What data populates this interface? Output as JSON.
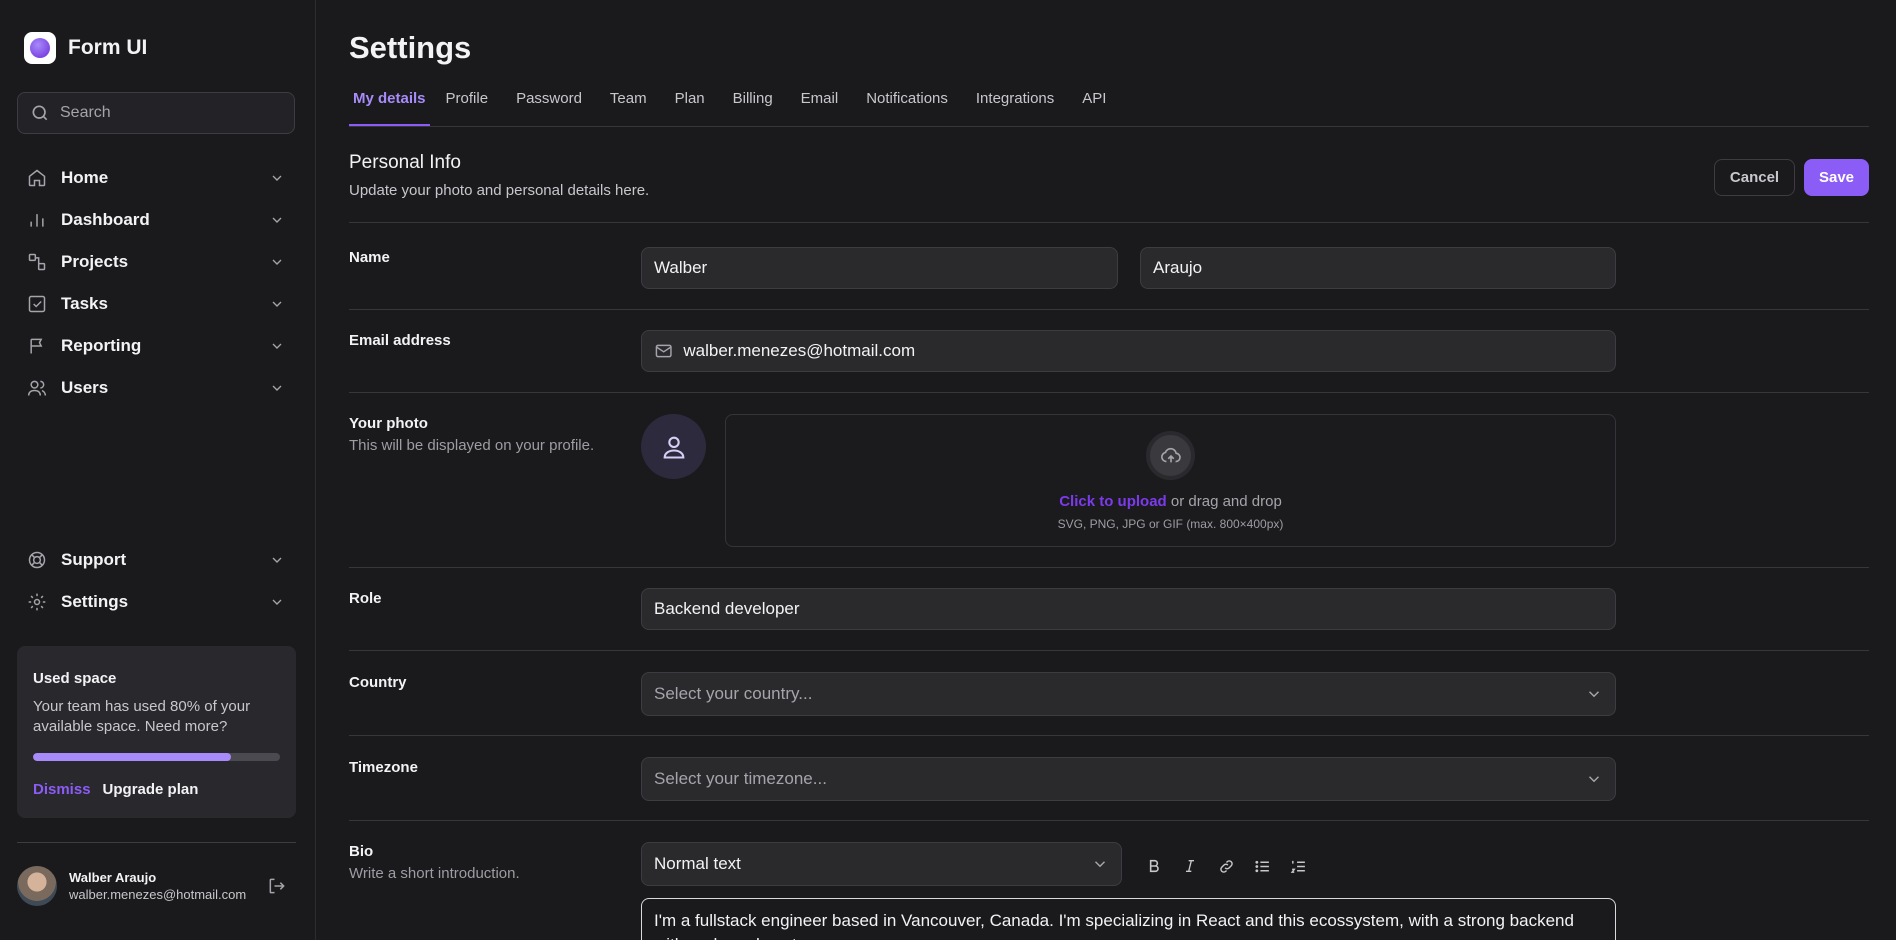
{
  "brand": {
    "name": "Form UI"
  },
  "search": {
    "placeholder": "Search"
  },
  "nav": {
    "main": [
      {
        "label": "Home",
        "icon": "home-icon"
      },
      {
        "label": "Dashboard",
        "icon": "bar-chart-icon"
      },
      {
        "label": "Projects",
        "icon": "projects-icon"
      },
      {
        "label": "Tasks",
        "icon": "check-square-icon"
      },
      {
        "label": "Reporting",
        "icon": "flag-icon"
      },
      {
        "label": "Users",
        "icon": "users-icon"
      }
    ],
    "footer": [
      {
        "label": "Support",
        "icon": "lifebuoy-icon"
      },
      {
        "label": "Settings",
        "icon": "gear-icon"
      }
    ]
  },
  "space": {
    "title": "Used space",
    "text": "Your team has used 80% of your available space. Need more?",
    "used_fraction": 0.8,
    "dismiss": "Dismiss",
    "upgrade": "Upgrade plan"
  },
  "user": {
    "name": "Walber Araujo",
    "email": "walber.menezes@hotmail.com"
  },
  "page": {
    "title": "Settings"
  },
  "tabs": [
    "My details",
    "Profile",
    "Password",
    "Team",
    "Plan",
    "Billing",
    "Email",
    "Notifications",
    "Integrations",
    "API"
  ],
  "section": {
    "title": "Personal Info",
    "subtitle": "Update your photo and personal details here.",
    "cancel": "Cancel",
    "save": "Save"
  },
  "form": {
    "name_label": "Name",
    "first_name": "Walber",
    "last_name": "Araujo",
    "email_label": "Email address",
    "email": "walber.menezes@hotmail.com",
    "photo_label": "Your photo",
    "photo_sub": "This will be displayed on your profile.",
    "upload_link": "Click to upload",
    "upload_rest": " or drag and drop",
    "upload_hint": "SVG, PNG, JPG or GIF (max. 800×400px)",
    "role_label": "Role",
    "role": "Backend developer",
    "country_label": "Country",
    "country_placeholder": "Select your country...",
    "timezone_label": "Timezone",
    "timezone_placeholder": "Select your timezone...",
    "bio_label": "Bio",
    "bio_sub": "Write a short introduction.",
    "bio_format": "Normal text",
    "bio_text": "I'm a fullstack engineer based in Vancouver, Canada. I'm specializing in React and this ecossystem, with a strong backend with node and postgres."
  },
  "colors": {
    "accent": "#8b5cf6",
    "accent_light": "#a78bfa",
    "background": "#1a191c"
  }
}
